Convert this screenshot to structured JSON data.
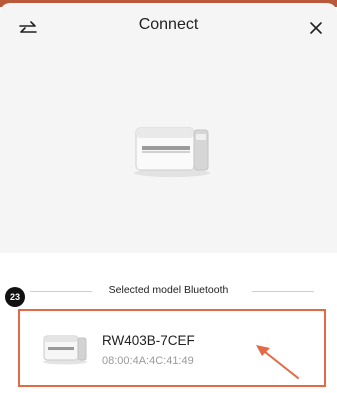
{
  "header": {
    "title": "Connect",
    "swap_icon": "swap-arrows-icon",
    "close_icon": "close-icon"
  },
  "hero": {
    "image": "label-printer-illustration"
  },
  "section": {
    "label": "Selected model Bluetooth"
  },
  "annotation": {
    "step": "23",
    "accent": "#e36a45"
  },
  "devices": [
    {
      "name": "RW403B-7CEF",
      "mac": "08:00:4A:4C:41:49"
    }
  ]
}
